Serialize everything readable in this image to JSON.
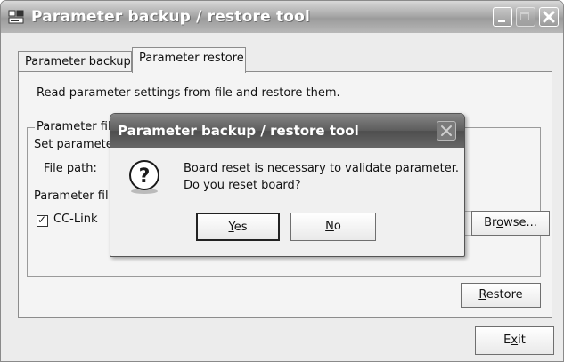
{
  "window": {
    "title": "Parameter backup / restore tool"
  },
  "tabs": [
    {
      "label": "Parameter backup",
      "active": false
    },
    {
      "label": "Parameter restore",
      "active": true
    }
  ],
  "panel": {
    "description": "Read parameter settings from file and restore them.",
    "group_label": "Parameter file",
    "set_params_label": "Set paramete",
    "file_path_label": "File path:",
    "params_file_label": "Parameter fil",
    "cc_link_checked": true,
    "cc_link_label": "CC-Link",
    "browse_prefix": "Br",
    "browse_mnemonic": "o",
    "browse_suffix": "wse...",
    "restore_mnemonic": "R",
    "restore_rest": "estore"
  },
  "footer": {
    "exit_prefix": "E",
    "exit_mnemonic": "x",
    "exit_suffix": "it"
  },
  "dialog": {
    "title": "Parameter backup / restore tool",
    "message_line1": "Board reset is necessary to validate parameter.",
    "message_line2": "Do you reset board?",
    "yes_mnemonic": "Y",
    "yes_rest": "es",
    "no_mnemonic": "N",
    "no_rest": "o",
    "icon": "question-icon"
  }
}
